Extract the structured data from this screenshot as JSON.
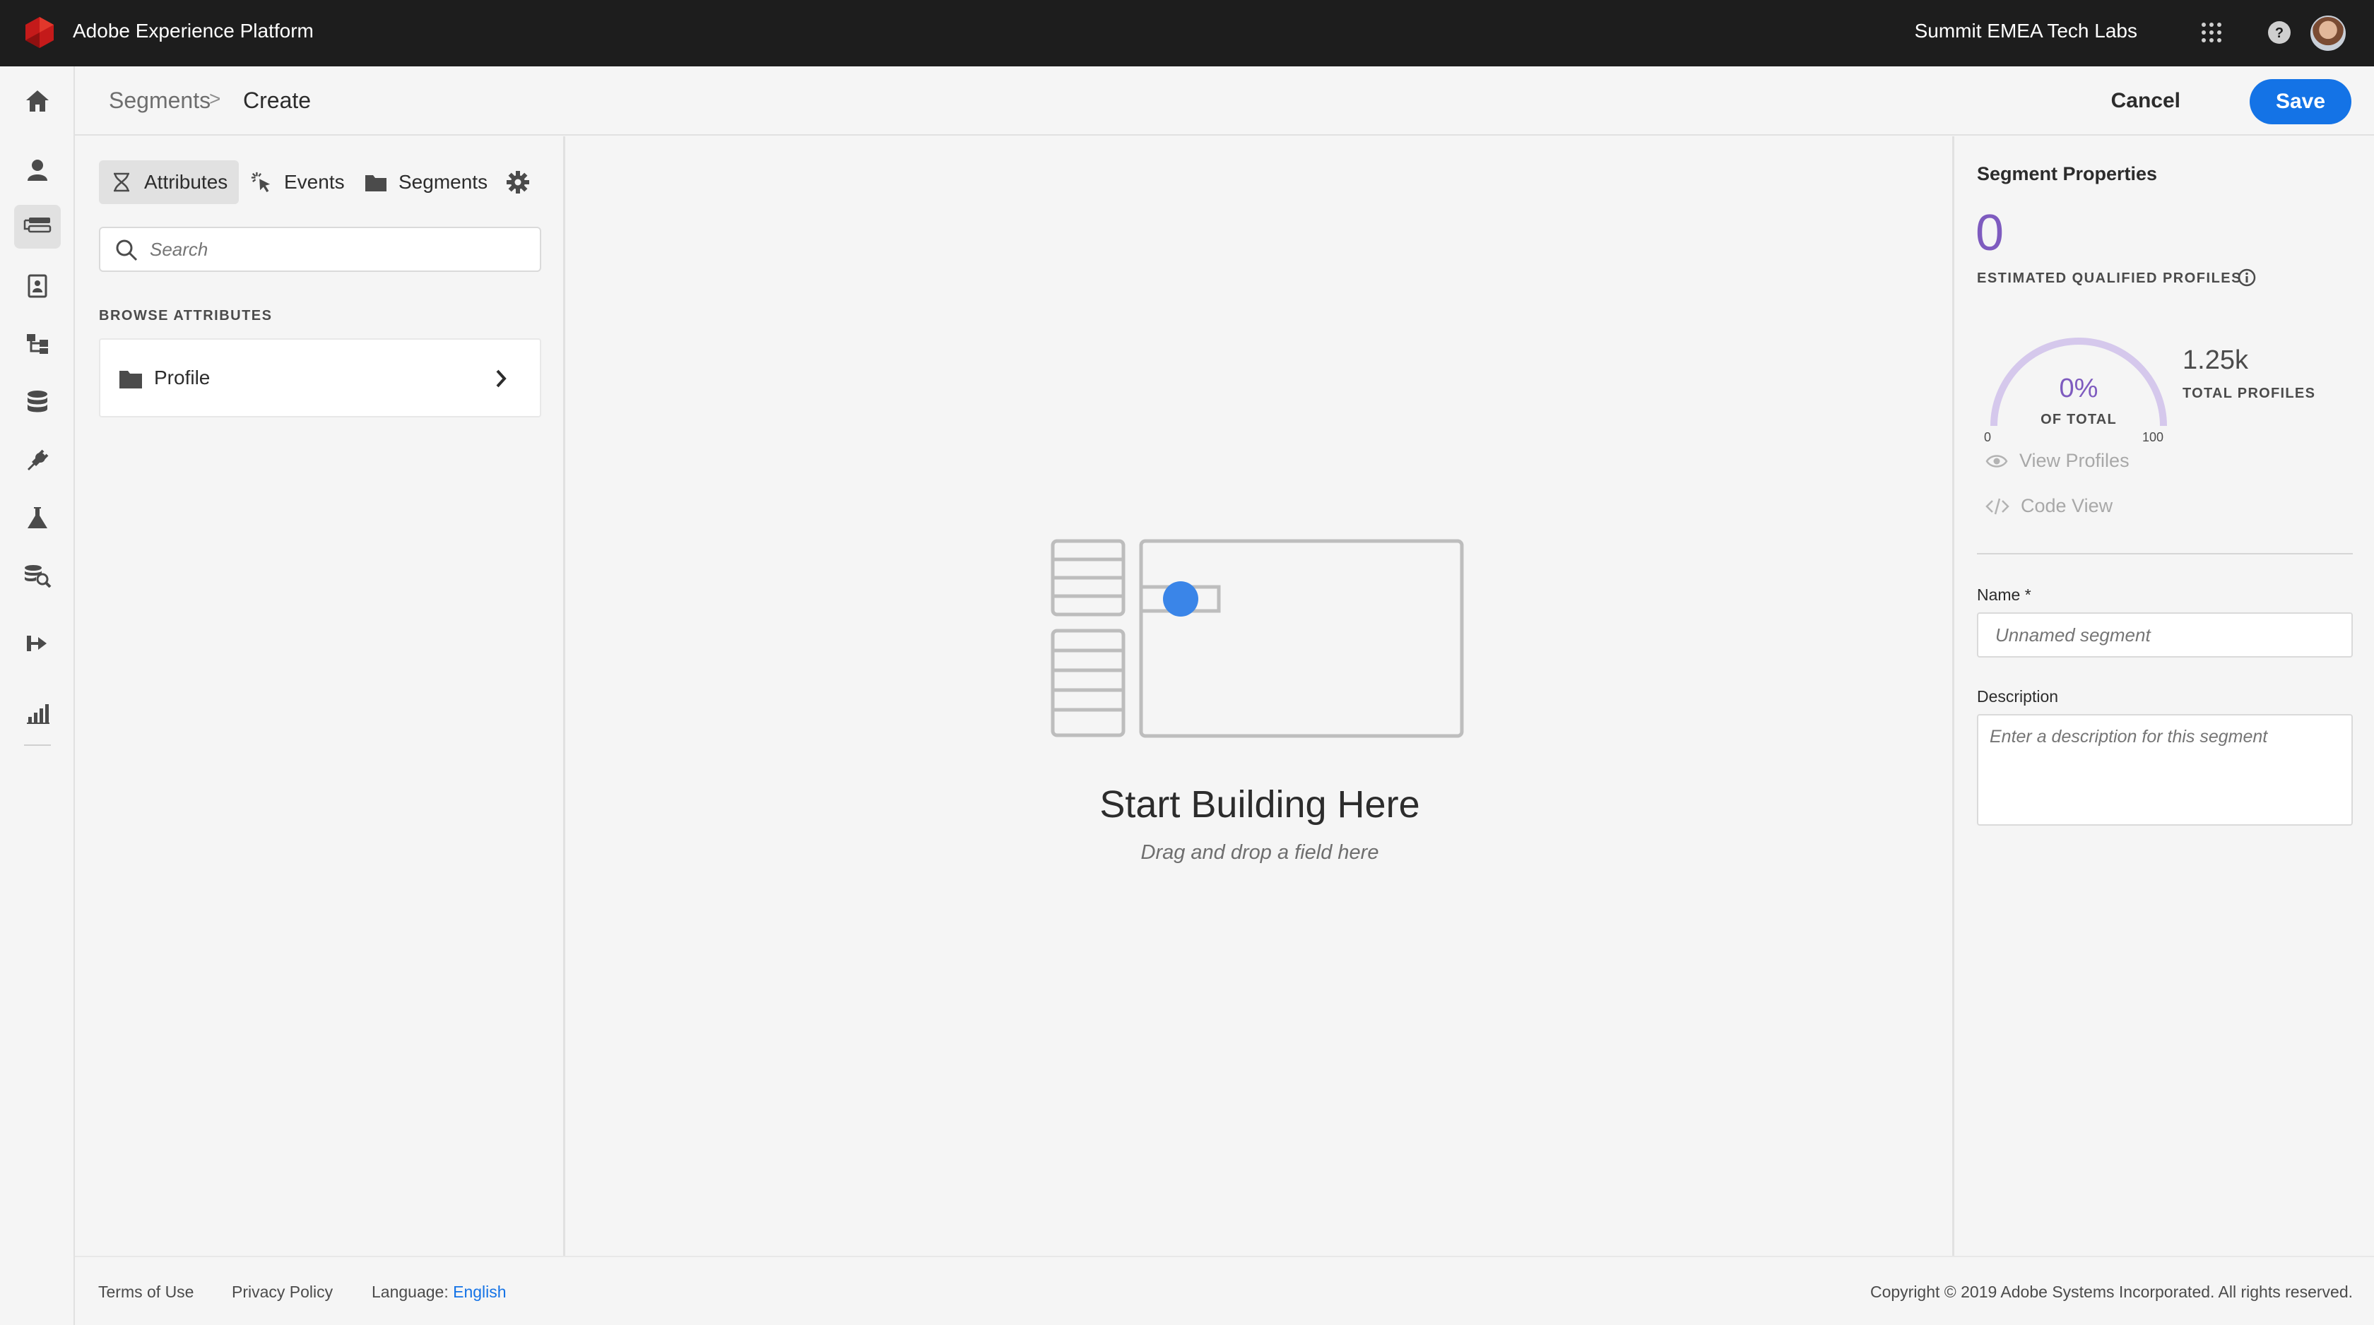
{
  "app": {
    "title": "Adobe Experience Platform",
    "org": "Summit EMEA Tech Labs"
  },
  "icons": {
    "logo": "adobe-logo-icon",
    "apps": "apps-grid-icon",
    "help": "help-icon",
    "rail": [
      "home-icon",
      "profiles-icon",
      "segments-icon",
      "identities-icon",
      "schemas-icon",
      "datasets-icon",
      "sources-icon",
      "sandbox-icon",
      "queries-icon",
      "destinations-icon",
      "monitoring-icon"
    ]
  },
  "breadcrumb": {
    "parent": "Segments",
    "separator": ">",
    "current": "Create"
  },
  "actions": {
    "cancel": "Cancel",
    "save": "Save"
  },
  "left_panel": {
    "tabs": [
      {
        "label": "Attributes",
        "active": true
      },
      {
        "label": "Events",
        "active": false
      },
      {
        "label": "Segments",
        "active": false
      }
    ],
    "search_placeholder": "Search",
    "browse_label": "BROWSE ATTRIBUTES",
    "items": [
      {
        "label": "Profile"
      }
    ]
  },
  "canvas": {
    "title": "Start Building Here",
    "subtitle": "Drag and drop a field here"
  },
  "properties": {
    "title": "Segment Properties",
    "estimated_count": "0",
    "estimated_label": "ESTIMATED QUALIFIED PROFILES",
    "gauge": {
      "percent_label": "0%",
      "percent_value": 0,
      "of_total_label": "OF TOTAL",
      "min": "0",
      "max": "100"
    },
    "total_value": "1.25k",
    "total_label": "TOTAL PROFILES",
    "view_profiles": "View Profiles",
    "code_view": "Code View",
    "name_label": "Name *",
    "name_placeholder": "Unnamed segment",
    "description_label": "Description",
    "description_placeholder": "Enter a description for this segment"
  },
  "footer": {
    "terms": "Terms of Use",
    "privacy": "Privacy Policy",
    "language_label": "Language:",
    "language_value": "English",
    "copyright": "Copyright  ©  2019 Adobe Systems Incorporated.  All rights reserved."
  },
  "colors": {
    "accent": "#1473e6",
    "topbar": "#1d1d1d",
    "gauge": "#7e5bbf",
    "gauge_track": "#d5c8ec"
  }
}
